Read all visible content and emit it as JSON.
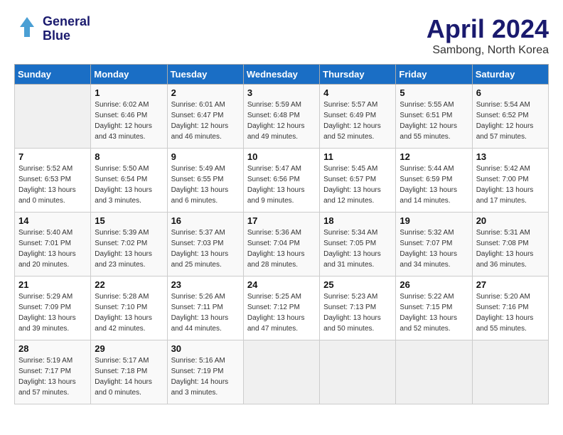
{
  "header": {
    "logo_line1": "General",
    "logo_line2": "Blue",
    "month": "April 2024",
    "location": "Sambong, North Korea"
  },
  "weekdays": [
    "Sunday",
    "Monday",
    "Tuesday",
    "Wednesday",
    "Thursday",
    "Friday",
    "Saturday"
  ],
  "weeks": [
    [
      {
        "day": "",
        "info": ""
      },
      {
        "day": "1",
        "info": "Sunrise: 6:02 AM\nSunset: 6:46 PM\nDaylight: 12 hours\nand 43 minutes."
      },
      {
        "day": "2",
        "info": "Sunrise: 6:01 AM\nSunset: 6:47 PM\nDaylight: 12 hours\nand 46 minutes."
      },
      {
        "day": "3",
        "info": "Sunrise: 5:59 AM\nSunset: 6:48 PM\nDaylight: 12 hours\nand 49 minutes."
      },
      {
        "day": "4",
        "info": "Sunrise: 5:57 AM\nSunset: 6:49 PM\nDaylight: 12 hours\nand 52 minutes."
      },
      {
        "day": "5",
        "info": "Sunrise: 5:55 AM\nSunset: 6:51 PM\nDaylight: 12 hours\nand 55 minutes."
      },
      {
        "day": "6",
        "info": "Sunrise: 5:54 AM\nSunset: 6:52 PM\nDaylight: 12 hours\nand 57 minutes."
      }
    ],
    [
      {
        "day": "7",
        "info": "Sunrise: 5:52 AM\nSunset: 6:53 PM\nDaylight: 13 hours\nand 0 minutes."
      },
      {
        "day": "8",
        "info": "Sunrise: 5:50 AM\nSunset: 6:54 PM\nDaylight: 13 hours\nand 3 minutes."
      },
      {
        "day": "9",
        "info": "Sunrise: 5:49 AM\nSunset: 6:55 PM\nDaylight: 13 hours\nand 6 minutes."
      },
      {
        "day": "10",
        "info": "Sunrise: 5:47 AM\nSunset: 6:56 PM\nDaylight: 13 hours\nand 9 minutes."
      },
      {
        "day": "11",
        "info": "Sunrise: 5:45 AM\nSunset: 6:57 PM\nDaylight: 13 hours\nand 12 minutes."
      },
      {
        "day": "12",
        "info": "Sunrise: 5:44 AM\nSunset: 6:59 PM\nDaylight: 13 hours\nand 14 minutes."
      },
      {
        "day": "13",
        "info": "Sunrise: 5:42 AM\nSunset: 7:00 PM\nDaylight: 13 hours\nand 17 minutes."
      }
    ],
    [
      {
        "day": "14",
        "info": "Sunrise: 5:40 AM\nSunset: 7:01 PM\nDaylight: 13 hours\nand 20 minutes."
      },
      {
        "day": "15",
        "info": "Sunrise: 5:39 AM\nSunset: 7:02 PM\nDaylight: 13 hours\nand 23 minutes."
      },
      {
        "day": "16",
        "info": "Sunrise: 5:37 AM\nSunset: 7:03 PM\nDaylight: 13 hours\nand 25 minutes."
      },
      {
        "day": "17",
        "info": "Sunrise: 5:36 AM\nSunset: 7:04 PM\nDaylight: 13 hours\nand 28 minutes."
      },
      {
        "day": "18",
        "info": "Sunrise: 5:34 AM\nSunset: 7:05 PM\nDaylight: 13 hours\nand 31 minutes."
      },
      {
        "day": "19",
        "info": "Sunrise: 5:32 AM\nSunset: 7:07 PM\nDaylight: 13 hours\nand 34 minutes."
      },
      {
        "day": "20",
        "info": "Sunrise: 5:31 AM\nSunset: 7:08 PM\nDaylight: 13 hours\nand 36 minutes."
      }
    ],
    [
      {
        "day": "21",
        "info": "Sunrise: 5:29 AM\nSunset: 7:09 PM\nDaylight: 13 hours\nand 39 minutes."
      },
      {
        "day": "22",
        "info": "Sunrise: 5:28 AM\nSunset: 7:10 PM\nDaylight: 13 hours\nand 42 minutes."
      },
      {
        "day": "23",
        "info": "Sunrise: 5:26 AM\nSunset: 7:11 PM\nDaylight: 13 hours\nand 44 minutes."
      },
      {
        "day": "24",
        "info": "Sunrise: 5:25 AM\nSunset: 7:12 PM\nDaylight: 13 hours\nand 47 minutes."
      },
      {
        "day": "25",
        "info": "Sunrise: 5:23 AM\nSunset: 7:13 PM\nDaylight: 13 hours\nand 50 minutes."
      },
      {
        "day": "26",
        "info": "Sunrise: 5:22 AM\nSunset: 7:15 PM\nDaylight: 13 hours\nand 52 minutes."
      },
      {
        "day": "27",
        "info": "Sunrise: 5:20 AM\nSunset: 7:16 PM\nDaylight: 13 hours\nand 55 minutes."
      }
    ],
    [
      {
        "day": "28",
        "info": "Sunrise: 5:19 AM\nSunset: 7:17 PM\nDaylight: 13 hours\nand 57 minutes."
      },
      {
        "day": "29",
        "info": "Sunrise: 5:17 AM\nSunset: 7:18 PM\nDaylight: 14 hours\nand 0 minutes."
      },
      {
        "day": "30",
        "info": "Sunrise: 5:16 AM\nSunset: 7:19 PM\nDaylight: 14 hours\nand 3 minutes."
      },
      {
        "day": "",
        "info": ""
      },
      {
        "day": "",
        "info": ""
      },
      {
        "day": "",
        "info": ""
      },
      {
        "day": "",
        "info": ""
      }
    ]
  ]
}
